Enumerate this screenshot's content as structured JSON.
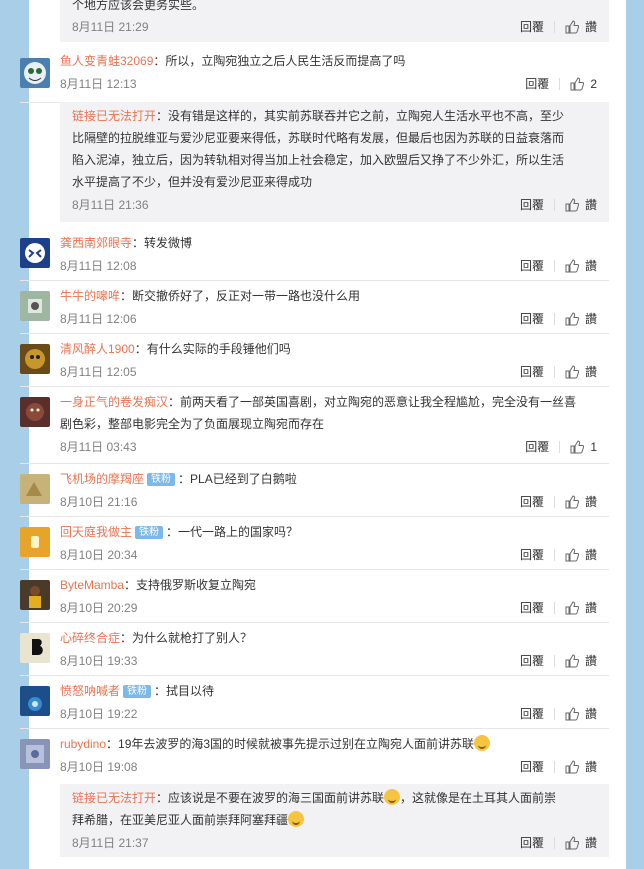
{
  "top_reply": {
    "text": "个地方应该会更务实些。",
    "time": "8月11日 21:29"
  },
  "reply_label": "回覆",
  "like_label": "讚",
  "comments": [
    {
      "name": "鱼人变青蛙32069",
      "badge": "",
      "text": "：所以，立陶宛独立之后人民生活反而提高了吗",
      "time": "8月11日 12:13",
      "likes": "2",
      "avatar_color": "#4a7fb0"
    },
    {
      "name": "龚西南郊眼寺",
      "badge": "",
      "text": "：转发微博",
      "time": "8月11日 12:08",
      "likes": "讚",
      "avatar_color": "#1d3f8c"
    },
    {
      "name": "牛牛的嗥哞",
      "badge": "",
      "text": "：断交撤侨好了，反正对一带一路也没什么用",
      "time": "8月11日 12:06",
      "likes": "讚",
      "avatar_color": "#9fb7a2"
    },
    {
      "name": "清风醉人1900",
      "badge": "",
      "text": "：有什么实际的手段锤他们吗",
      "time": "8月11日 12:05",
      "likes": "讚",
      "avatar_color": "#6b4a1a"
    },
    {
      "name": "一身正气的卷发痴汉",
      "badge": "",
      "text": "：前两天看了一部英国喜剧，对立陶宛的恶意让我全程尴尬，完全没有一丝喜",
      "text2": "剧色彩，整部电影完全为了负面展现立陶宛而存在",
      "time": "8月11日 03:43",
      "likes": "1",
      "avatar_color": "#5a2e2a"
    },
    {
      "name": "飞机场的摩羯座",
      "badge": "铁粉",
      "text": "：PLA已经到了白鹅啦",
      "time": "8月10日 21:16",
      "likes": "讚",
      "avatar_color": "#c7b27a"
    },
    {
      "name": "回天庭我做主",
      "badge": "铁粉",
      "text": "：一代一路上的国家吗？",
      "time": "8月10日 20:34",
      "likes": "讚",
      "avatar_color": "#e6a52a"
    },
    {
      "name": "ByteMamba",
      "badge": "",
      "text": "：支持俄罗斯收复立陶宛",
      "time": "8月10日 20:29",
      "likes": "讚",
      "avatar_color": "#4a3a2a"
    },
    {
      "name": "心碎终合症",
      "badge": "",
      "text": "：为什么就枪打了别人？",
      "time": "8月10日 19:33",
      "likes": "讚",
      "avatar_color": "#e9e4d0"
    },
    {
      "name": "愤怒呐喊者",
      "badge": "铁粉",
      "text": "：拭目以待",
      "time": "8月10日 19:22",
      "likes": "讚",
      "avatar_color": "#1c4f8a"
    },
    {
      "name": "rubydino",
      "badge": "",
      "text": "：19年去波罗的海3国的时候就被事先提示过别在立陶宛人面前讲苏联",
      "time": "8月10日 19:08",
      "likes": "讚",
      "avatar_color": "#8a94b8"
    }
  ],
  "sub_replies": [
    {
      "name": "链接已无法打开",
      "lines": [
        "：没有错是这样的，其实前苏联吞并它之前，立陶宛人生活水平也不高，至少",
        "比隔壁的拉脱维亚与爱沙尼亚要来得低，苏联时代略有发展，但最后也因为苏联的日益衰落而",
        "陷入泥淖，独立后，因为转轨相对得当加上社会稳定，加入欧盟后又挣了不少外汇，所以生活",
        "水平提高了不少，但并没有爱沙尼亚来得成功"
      ],
      "time": "8月11日 21:36"
    },
    {
      "name": "链接已无法打开",
      "lines": [
        "：应该说是不要在波罗的海三国面前讲苏联",
        "，这就像是在土耳其人面前崇",
        "拜希腊，在亚美尼亚人面前崇拜阿塞拜疆"
      ],
      "time": "8月11日 21:37"
    }
  ]
}
